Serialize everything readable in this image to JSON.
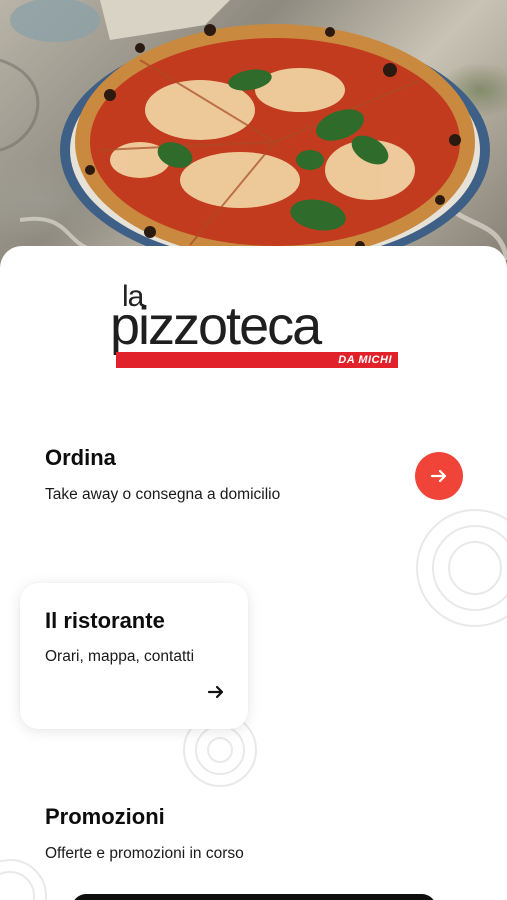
{
  "brand": {
    "logo_prefix": "la",
    "logo_word": "pizzoteca",
    "logo_tagline": "DA MICHI",
    "accent_color": "#e2222b"
  },
  "hero": {
    "image": "pizza-photo"
  },
  "order": {
    "title": "Ordina",
    "subtitle": "Take away o consegna a domicilio",
    "button_icon": "arrow-right-icon",
    "button_color": "#ef4437"
  },
  "restaurant": {
    "title": "Il ristorante",
    "subtitle": "Orari, mappa, contatti",
    "icon": "arrow-right-icon"
  },
  "promotions": {
    "title": "Promozioni",
    "subtitle": "Offerte e promozioni in corso"
  }
}
